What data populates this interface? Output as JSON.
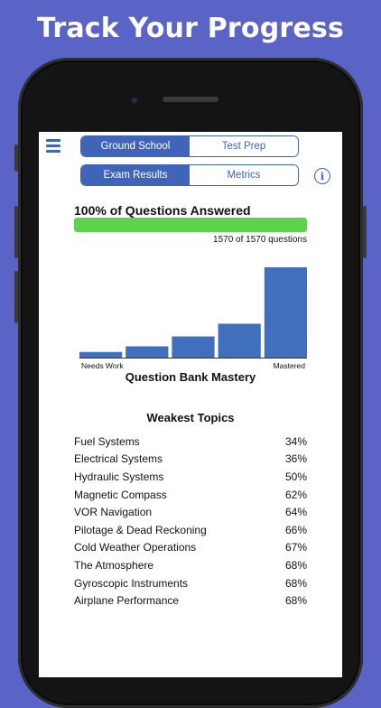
{
  "headline": "Track Your Progress",
  "nav": {
    "primary_tabs": [
      {
        "label": "Ground School",
        "active": true
      },
      {
        "label": "Test Prep",
        "active": false
      }
    ],
    "secondary_tabs": [
      {
        "label": "Exam Results",
        "active": true
      },
      {
        "label": "Metrics",
        "active": false
      }
    ],
    "info_glyph": "i"
  },
  "progress": {
    "title": "100% of Questions Answered",
    "fraction": 1.0,
    "count_text": "1570 of 1570 questions"
  },
  "chart_data": {
    "type": "bar",
    "title": "Question Bank Mastery",
    "values": [
      4,
      8,
      15,
      24,
      64
    ],
    "ylim": [
      0,
      64
    ],
    "start_label": "Needs Work",
    "end_label": "Mastered",
    "bar_color": "#3f6fbd"
  },
  "topics": {
    "title": "Weakest Topics",
    "items": [
      {
        "name": "Fuel Systems",
        "percent": "34%"
      },
      {
        "name": "Electrical Systems",
        "percent": "36%"
      },
      {
        "name": "Hydraulic Systems",
        "percent": "50%"
      },
      {
        "name": "Magnetic Compass",
        "percent": "62%"
      },
      {
        "name": "VOR Navigation",
        "percent": "64%"
      },
      {
        "name": "Pilotage & Dead Reckoning",
        "percent": "66%"
      },
      {
        "name": "Cold Weather Operations",
        "percent": "67%"
      },
      {
        "name": "The Atmosphere",
        "percent": "68%"
      },
      {
        "name": "Gyroscopic Instruments",
        "percent": "68%"
      },
      {
        "name": "Airplane Performance",
        "percent": "68%"
      }
    ]
  },
  "colors": {
    "background": "#5a63c6",
    "accent": "#3f64b8",
    "progress_fill": "#5ed24c"
  },
  "icons": [
    "hamburger-menu-icon",
    "info-icon"
  ]
}
